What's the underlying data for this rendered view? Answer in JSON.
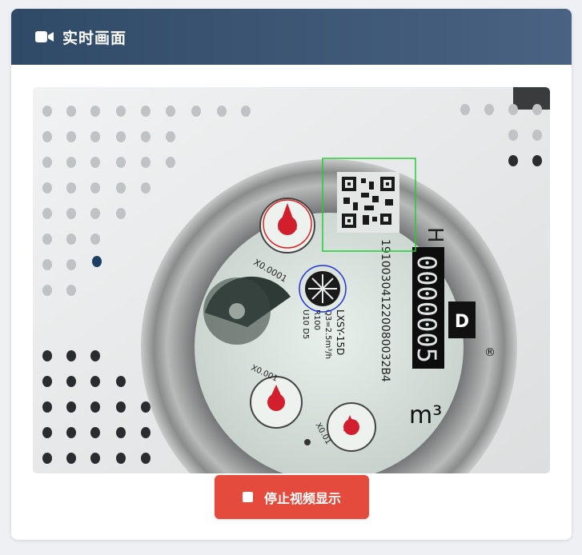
{
  "panel": {
    "title": "实时画面",
    "icon": "video-camera-icon"
  },
  "video": {
    "meter_model": "LXSY-15D",
    "meter_spec_q3": "Q3=2.5m³/h",
    "meter_spec_r": "R100",
    "meter_spec_u": "U10  D5",
    "serial_number": "191003041220080032B4",
    "reading_digits": "0000005",
    "unit_label": "m³",
    "dial_x0001": "X0.0001",
    "dial_x001": "X0.001",
    "dial_x01": "X0.01",
    "brand_logo": "D",
    "registered_mark": "®",
    "h_mark": "H"
  },
  "colors": {
    "header_start": "#2f4a66",
    "header_end": "#4a6283",
    "stop_button": "#e44b3d",
    "qr_detection_box": "#22cc33",
    "dial_detection_red": "#dd2222",
    "dial_detection_blue": "#2233dd"
  },
  "actions": {
    "stop_label": "停止视频显示",
    "stop_icon": "stop-square-icon"
  }
}
